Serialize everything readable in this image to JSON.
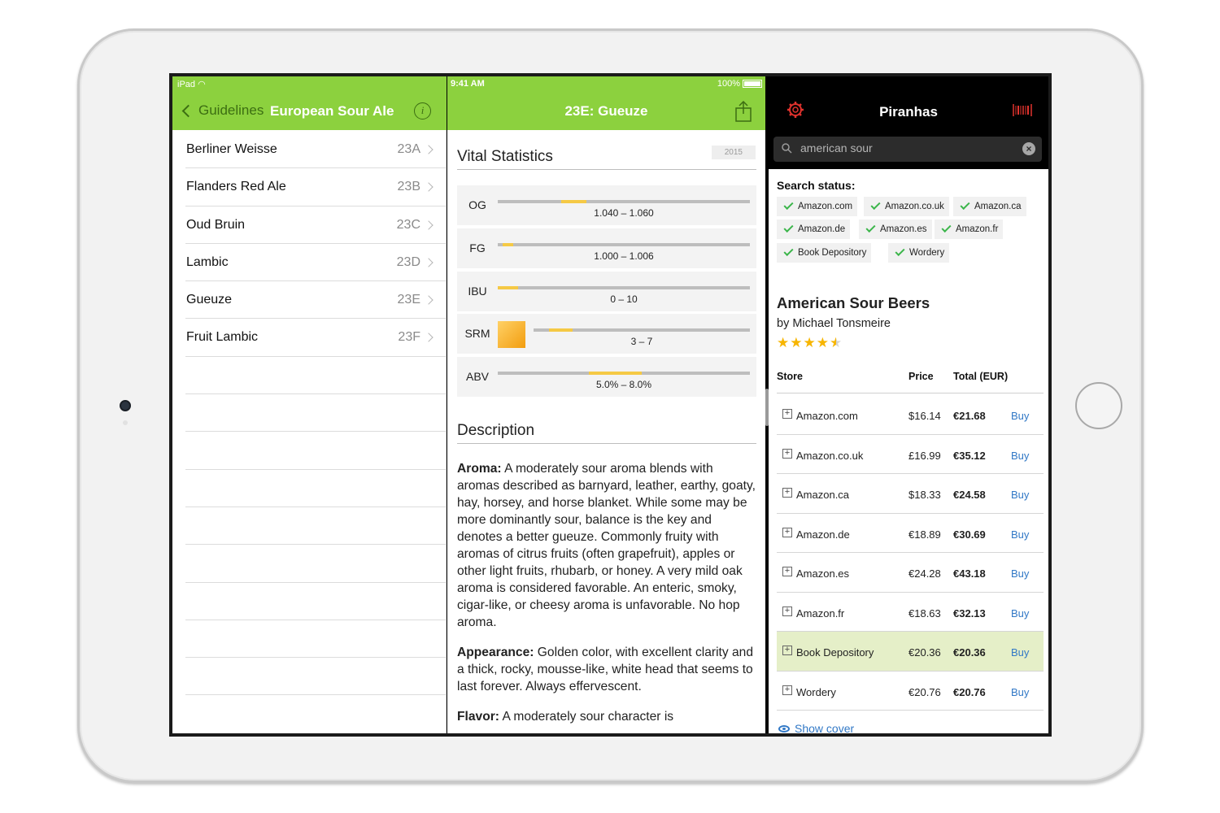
{
  "left": {
    "status_carrier": "iPad",
    "back_label": "Guidelines",
    "title": "European Sour Ale",
    "info_icon": "i",
    "styles": [
      {
        "name": "Berliner Weisse",
        "code": "23A"
      },
      {
        "name": "Flanders Red Ale",
        "code": "23B"
      },
      {
        "name": "Oud Bruin",
        "code": "23C"
      },
      {
        "name": "Lambic",
        "code": "23D"
      },
      {
        "name": "Gueuze",
        "code": "23E"
      },
      {
        "name": "Fruit Lambic",
        "code": "23F"
      }
    ]
  },
  "middle": {
    "status_time": "9:41 AM",
    "status_battery": "100%",
    "title": "23E: Gueuze",
    "vital_title": "Vital Statistics",
    "year_badge": "2015",
    "stats": [
      {
        "label": "OG",
        "range": "1.040 – 1.060",
        "fill_start": 0.25,
        "fill_end": 0.35
      },
      {
        "label": "FG",
        "range": "1.000 – 1.006",
        "fill_start": 0.02,
        "fill_end": 0.06
      },
      {
        "label": "IBU",
        "range": "0 – 10",
        "fill_start": 0.0,
        "fill_end": 0.08
      },
      {
        "label": "SRM",
        "range": "3 – 7",
        "fill_start": 0.07,
        "fill_end": 0.18
      },
      {
        "label": "ABV",
        "range": "5.0% – 8.0%",
        "fill_start": 0.36,
        "fill_end": 0.57
      }
    ],
    "srm_color": "#f5a623",
    "description_title": "Description",
    "description": [
      {
        "label": "Aroma:",
        "text": " A moderately sour aroma blends with aromas described as barnyard, leather, earthy, goaty, hay, horsey, and horse blanket. While some may be more dominantly sour, balance is the key and denotes a better gueuze. Commonly fruity with aromas of citrus fruits (often grapefruit), apples or other light fruits, rhubarb, or honey. A very mild oak aroma is considered favorable. An enteric, smoky, cigar-like, or cheesy aroma is unfavorable. No hop aroma."
      },
      {
        "label": "Appearance:",
        "text": " Golden color, with excellent clarity and a thick, rocky, mousse-like, white head that seems to last forever. Always effervescent."
      },
      {
        "label": "Flavor:",
        "text": " A moderately sour character is"
      }
    ]
  },
  "right": {
    "title": "Piranhas",
    "search_value": "american sour",
    "search_status_title": "Search status:",
    "search_stores": [
      "Amazon.com",
      "Amazon.co.uk",
      "Amazon.ca",
      "Amazon.de",
      "Amazon.es",
      "Amazon.fr",
      "Book Depository",
      "Wordery"
    ],
    "book_title": "American Sour Beers",
    "book_author": "by Michael Tonsmeire",
    "rating": 4.5,
    "table_headers": {
      "store": "Store",
      "price": "Price",
      "total": "Total (EUR)"
    },
    "offers": [
      {
        "store": "Amazon.com",
        "price": "$16.14",
        "total": "€21.68",
        "buy": "Buy",
        "highlight": false
      },
      {
        "store": "Amazon.co.uk",
        "price": "£16.99",
        "total": "€35.12",
        "buy": "Buy",
        "highlight": false
      },
      {
        "store": "Amazon.ca",
        "price": "$18.33",
        "total": "€24.58",
        "buy": "Buy",
        "highlight": false
      },
      {
        "store": "Amazon.de",
        "price": "€18.89",
        "total": "€30.69",
        "buy": "Buy",
        "highlight": false
      },
      {
        "store": "Amazon.es",
        "price": "€24.28",
        "total": "€43.18",
        "buy": "Buy",
        "highlight": false
      },
      {
        "store": "Amazon.fr",
        "price": "€18.63",
        "total": "€32.13",
        "buy": "Buy",
        "highlight": false
      },
      {
        "store": "Book Depository",
        "price": "€20.36",
        "total": "€20.36",
        "buy": "Buy",
        "highlight": true
      },
      {
        "store": "Wordery",
        "price": "€20.76",
        "total": "€20.76",
        "buy": "Buy",
        "highlight": false
      }
    ],
    "show_cover": "Show cover"
  },
  "colors": {
    "accent_green": "#8cd13e",
    "rating_star": "#f7b500",
    "link_blue": "#3178c6",
    "check_green": "#3bb54a",
    "highlight_row": "#e5efc8"
  }
}
